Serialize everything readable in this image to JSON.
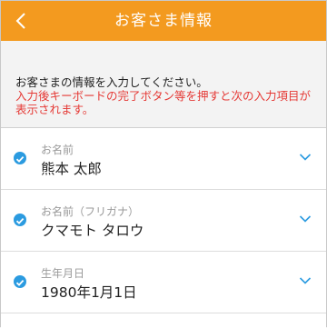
{
  "header": {
    "title": "お客さま情報",
    "back_icon": "chevron-left-icon",
    "background": "#f39a1f"
  },
  "notice": {
    "line1": "お客さまの情報を入力してください。",
    "line2": "入力後キーボードの完了ボタン等を押すと次の入力項目が表示されます。",
    "warning_color": "#e53935"
  },
  "fields": [
    {
      "label": "お名前",
      "value": "熊本 太郎"
    },
    {
      "label": "お名前（フリガナ）",
      "value": "クマモト タロウ"
    },
    {
      "label": "生年月日",
      "value": "1980年1月1日"
    }
  ],
  "icons": {
    "check": "check-circle-icon",
    "expand": "chevron-down-icon"
  },
  "accent": "#2b9be0"
}
